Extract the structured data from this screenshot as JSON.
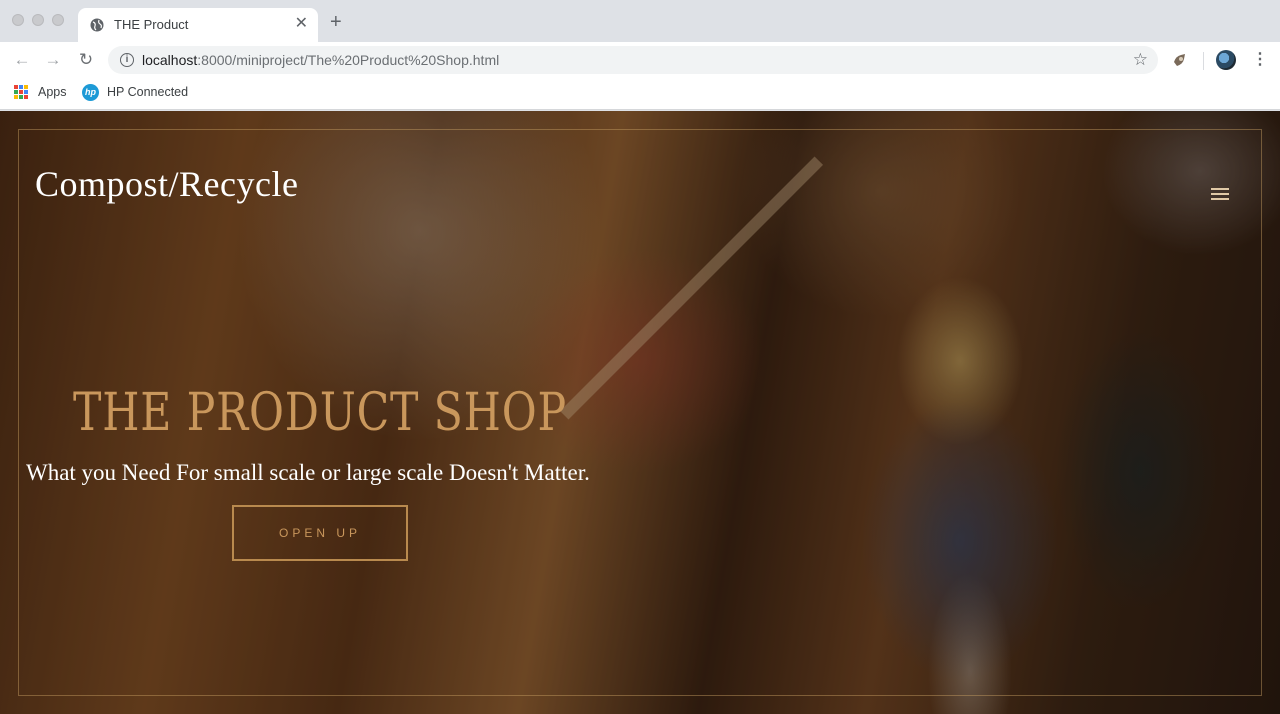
{
  "browser": {
    "tab_title": "THE Product",
    "tab_close": "✕",
    "new_tab": "+",
    "url_host": "localhost",
    "url_rest": ":8000/miniproject/The%20Product%20Shop.html",
    "bookmarks": [
      {
        "label": "Apps",
        "icon": "apps-grid-icon"
      },
      {
        "label": "HP Connected",
        "icon": "hp-logo-icon"
      }
    ]
  },
  "page": {
    "brand": "Compost/Recycle",
    "hero_title": "THE PRODUCT SHOP",
    "hero_subtitle": "What you Need For small scale or large scale Doesn't Matter.",
    "cta_label": "OPEN UP"
  },
  "colors": {
    "accent_gold": "#c9975c",
    "button_border": "#b98a4e",
    "frame_line": "#c8a064"
  }
}
